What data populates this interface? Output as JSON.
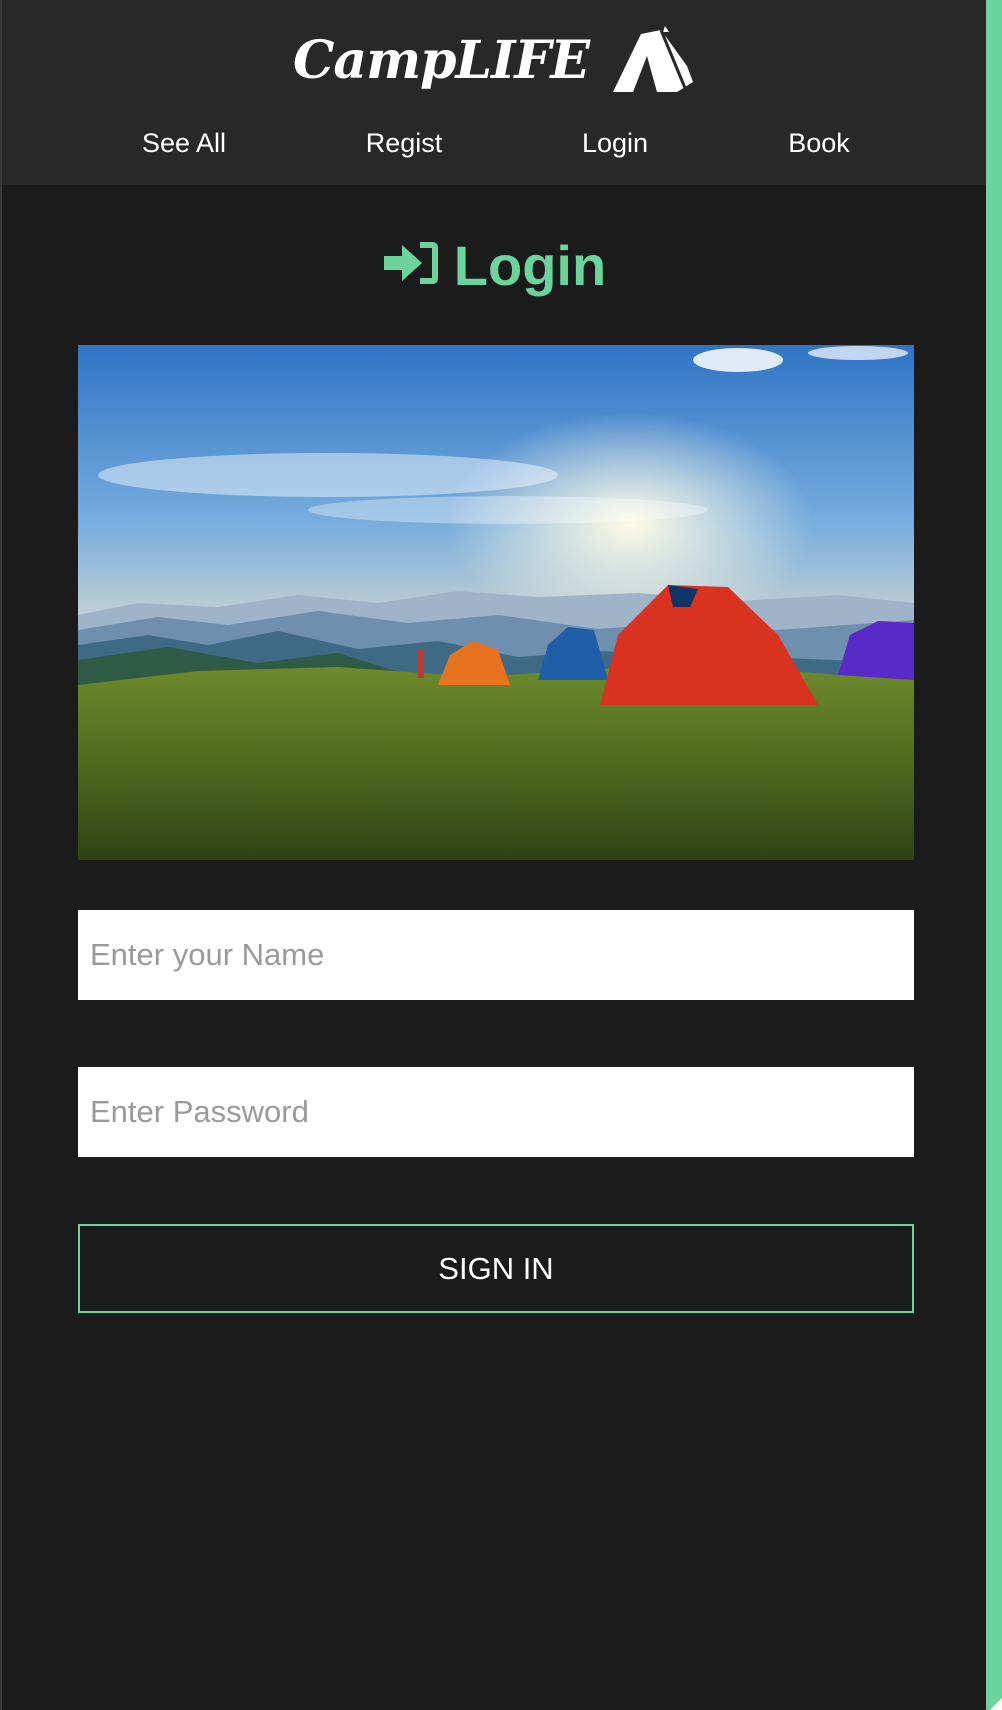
{
  "brand": {
    "name": "CampLIFE",
    "icon": "tent-icon"
  },
  "nav": {
    "items": [
      {
        "label": "See All"
      },
      {
        "label": "Regist"
      },
      {
        "label": "Login"
      },
      {
        "label": "Book"
      }
    ]
  },
  "main": {
    "title": "Login",
    "title_icon": "sign-in-icon",
    "image_alt": "camping tents on a grassy hill at sunset",
    "name_placeholder": "Enter your Name",
    "password_placeholder": "Enter Password",
    "submit_label": "SIGN IN"
  },
  "colors": {
    "accent": "#6bd49d",
    "background": "#1b1b1b",
    "header": "#282828"
  }
}
